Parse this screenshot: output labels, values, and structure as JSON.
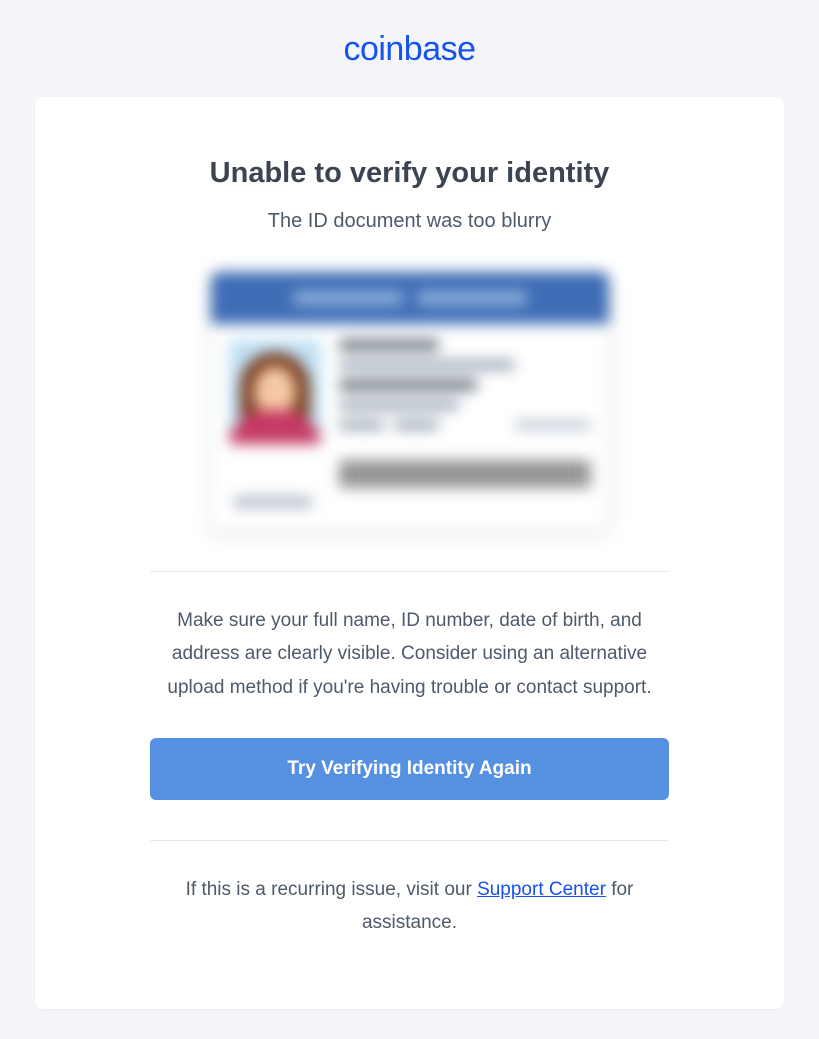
{
  "brand": {
    "name": "coinbase"
  },
  "heading": "Unable to verify your identity",
  "subheading": "The ID document was too blurry",
  "help_text": "Make sure your full name, ID number, date of birth, and address are clearly visible. Consider using an alternative upload method if you're having trouble or contact support.",
  "cta": {
    "label": "Try Verifying Identity Again"
  },
  "footer": {
    "prefix": "If this is a recurring issue, visit our ",
    "link_label": "Support Center",
    "suffix": " for assistance."
  }
}
